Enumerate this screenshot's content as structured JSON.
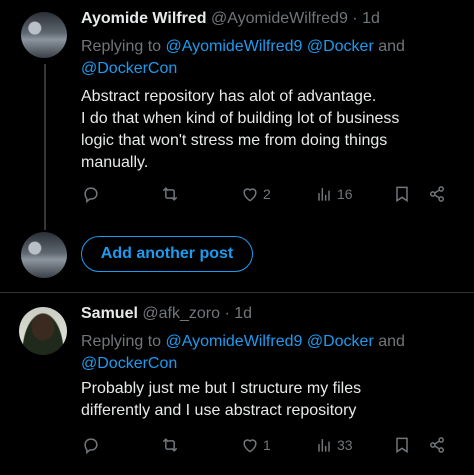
{
  "tweets": [
    {
      "name": "Ayomide Wilfred",
      "handle": "@AyomideWilfred9",
      "time": "· 1d",
      "replying_label": "Replying to",
      "mentions": [
        "@AyomideWilfred9",
        "@Docker",
        "@DockerCon"
      ],
      "and_word": "and",
      "lines": [
        "Abstract repository has alot of advantage.",
        "I do that when kind of building lot of business",
        "logic that won't stress me from doing things",
        "manually."
      ],
      "likes": "2",
      "views": "16"
    },
    {
      "name": "Samuel",
      "handle": "@afk_zoro",
      "time": "· 1d",
      "replying_label": "Replying to",
      "mentions": [
        "@AyomideWilfred9",
        "@Docker",
        "@DockerCon"
      ],
      "and_word": "and",
      "lines": [
        "Probably just me but I structure my files",
        "differently and I use abstract repository"
      ],
      "likes": "1",
      "views": "33"
    }
  ],
  "compose": {
    "add_label": "Add another post"
  },
  "icons": [
    "reply-icon",
    "retweet-icon",
    "like-icon",
    "views-icon",
    "bookmark-icon",
    "share-icon"
  ],
  "colors": {
    "background": "#000000",
    "accent": "#1d9bf0",
    "muted": "#71767b",
    "text": "#e7e9ea"
  }
}
